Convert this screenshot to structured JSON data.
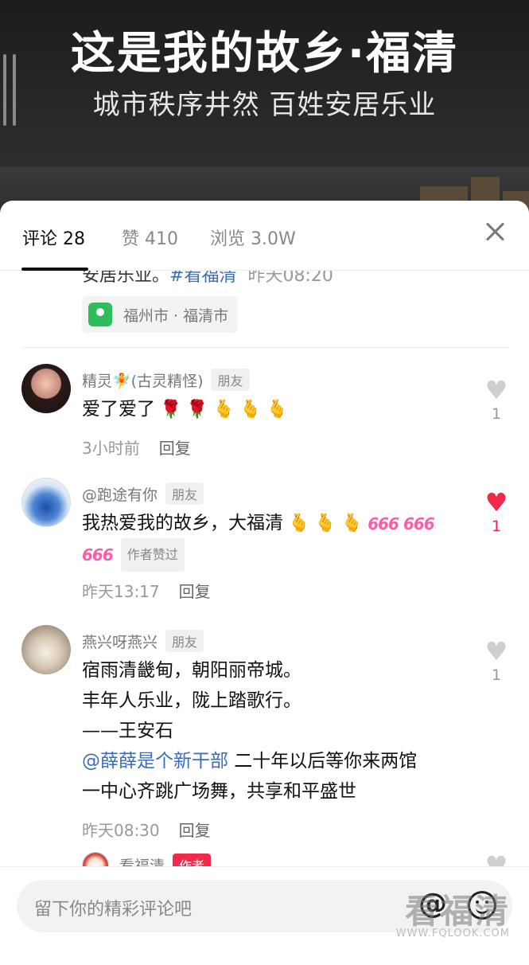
{
  "video": {
    "title": "这是我的故乡·福清",
    "subtitle": "城市秩序井然 百姓安居乐业"
  },
  "tabs": {
    "comments": "评论 28",
    "likes": "赞 410",
    "views": "浏览 3.0W"
  },
  "post": {
    "caption_tail": "安居乐业。",
    "hashtag": "#看福清",
    "time": "昨天08:20",
    "location": "福州市 · 福清市"
  },
  "comments": [
    {
      "user": "精灵🧚(古灵精怪)",
      "badge": "朋友",
      "text": "爱了爱了",
      "time": "3小时前",
      "reply": "回复",
      "likes": "1",
      "liked": false
    },
    {
      "user": "@跑途有你",
      "badge": "朋友",
      "text": "我热爱我的故乡，大福清",
      "author_liked": "作者赞过",
      "time": "昨天13:17",
      "reply": "回复",
      "likes": "1",
      "liked": true
    },
    {
      "user": "燕兴呀燕兴",
      "badge": "朋友",
      "line1": "宿雨清畿甸，朝阳丽帝城。",
      "line2": "丰年人乐业，陇上踏歌行。",
      "line3": "——王安石",
      "mention": "@薛薛是个新干部",
      "line4": " 二十年以后等你来两馆",
      "line5": "一中心齐跳广场舞，共享和平盛世",
      "time": "昨天08:30",
      "reply": "回复",
      "likes": "1",
      "liked": false
    },
    {
      "user": "看福清",
      "badge": "作者"
    }
  ],
  "input": {
    "placeholder": "留下你的精彩评论吧"
  },
  "watermark": {
    "big": "看福清",
    "url": "WWW.FQLOOK.COM"
  },
  "icons": {
    "close": "close-icon",
    "location": "location-pin-icon",
    "heart": "heart-icon",
    "at": "at-icon",
    "emoji": "smile-icon"
  },
  "colors": {
    "like_active": "#f2294a",
    "mention": "#3a6db5",
    "location_green": "#2dbd5c"
  }
}
